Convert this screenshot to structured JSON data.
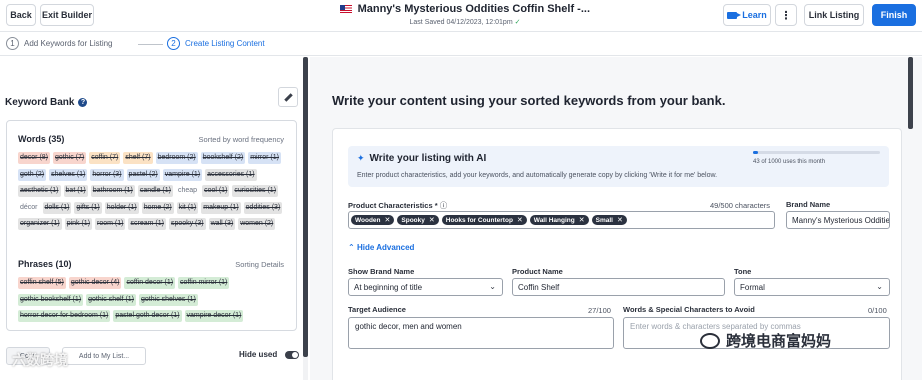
{
  "topbar": {
    "back": "Back",
    "exit": "Exit Builder",
    "title": "Manny's Mysterious Oddities Coffin Shelf -...",
    "saved": "Last Saved 04/12/2023, 12:01pm",
    "learn": "Learn",
    "more": "⋮",
    "link_listing": "Link Listing",
    "finish": "Finish"
  },
  "steps": [
    {
      "num": "1",
      "label": "Add Keywords for Listing"
    },
    {
      "num": "2",
      "label": "Create Listing Content"
    }
  ],
  "keyword_bank": {
    "title": "Keyword Bank",
    "words_title": "Words (35)",
    "words_note": "Sorted by word frequency",
    "words": [
      {
        "text": "decor (8)",
        "c": "p"
      },
      {
        "text": "gothic (7)",
        "c": "p"
      },
      {
        "text": "coffin (7)",
        "c": "o"
      },
      {
        "text": "shelf (7)",
        "c": "o"
      },
      {
        "text": "bedroom (2)",
        "c": "b"
      },
      {
        "text": "bookshelf (2)",
        "c": "b"
      },
      {
        "text": "mirror (1)",
        "c": "b"
      },
      {
        "text": "goth (2)",
        "c": "b"
      },
      {
        "text": "shelves (1)",
        "c": "b"
      },
      {
        "text": "horror (3)",
        "c": "b"
      },
      {
        "text": "pastel (2)",
        "c": "b"
      },
      {
        "text": "vampire (1)",
        "c": "b"
      },
      {
        "text": "accessories (1)",
        "c": "g"
      },
      {
        "text": "aesthetic (1)",
        "c": "g"
      },
      {
        "text": "bat (1)",
        "c": "g"
      },
      {
        "text": "bathroom (1)",
        "c": "g"
      },
      {
        "text": "candle (1)",
        "c": "g"
      },
      {
        "text": "cheap",
        "c": "n"
      },
      {
        "text": "cool (1)",
        "c": "g"
      },
      {
        "text": "curiosities (1)",
        "c": "g"
      },
      {
        "text": "décor",
        "c": "n"
      },
      {
        "text": "dolls (1)",
        "c": "g"
      },
      {
        "text": "gifts (1)",
        "c": "g"
      },
      {
        "text": "holder (1)",
        "c": "g"
      },
      {
        "text": "home (2)",
        "c": "g"
      },
      {
        "text": "kit (1)",
        "c": "g"
      },
      {
        "text": "makeup (1)",
        "c": "g"
      },
      {
        "text": "oddities (3)",
        "c": "g"
      },
      {
        "text": "organizer (1)",
        "c": "g"
      },
      {
        "text": "pink (1)",
        "c": "g"
      },
      {
        "text": "room (1)",
        "c": "g"
      },
      {
        "text": "scream (1)",
        "c": "g"
      },
      {
        "text": "spooky (3)",
        "c": "g"
      },
      {
        "text": "wall (3)",
        "c": "g"
      },
      {
        "text": "women (2)",
        "c": "g"
      }
    ],
    "phrases_title": "Phrases (10)",
    "phrases_note": "Sorting Details",
    "phrases": [
      {
        "text": "coffin shelf (5)",
        "c": "p"
      },
      {
        "text": "gothic decor (4)",
        "c": "p"
      },
      {
        "text": "coffin decor (1)",
        "c": "gr"
      },
      {
        "text": "coffin mirror (1)",
        "c": "gr"
      },
      {
        "text": "gothic bookshelf (1)",
        "c": "gr"
      },
      {
        "text": "gothic shelf (1)",
        "c": "gr"
      },
      {
        "text": "gothic shelves (1)",
        "c": "gr"
      },
      {
        "text": "horror decor for bedroom (1)",
        "c": "gr"
      },
      {
        "text": "pastel goth decor (1)",
        "c": "gr"
      },
      {
        "text": "vampire decor (1)",
        "c": "gr"
      }
    ],
    "copy_btn": "Copy",
    "add_to_list": "Add to My List...",
    "hide_used": "Hide used"
  },
  "main": {
    "headline": "Write your content using your sorted keywords from your bank.",
    "ai": {
      "title": "Write your listing with AI",
      "subtitle": "Enter product characteristics, add your keywords, and automatically generate copy by clicking 'Write it for me' below.",
      "usage_text": "43 of 1000 uses this month",
      "usage_fraction": 0.043
    },
    "product_characteristics": {
      "label": "Product Characteristics *",
      "counter": "49/500 characters",
      "tags": [
        "Wooden",
        "Spooky",
        "Hooks for Countertop",
        "Wall Hanging",
        "Small"
      ]
    },
    "brand_name": {
      "label": "Brand Name",
      "value": "Manny's Mysterious Oddities"
    },
    "hide_advanced": "Hide Advanced",
    "show_brand_name": {
      "label": "Show Brand Name",
      "value": "At beginning of title"
    },
    "product_name": {
      "label": "Product Name",
      "value": "Coffin Shelf"
    },
    "tone": {
      "label": "Tone",
      "value": "Formal"
    },
    "target_audience": {
      "label": "Target Audience",
      "counter": "27/100",
      "value": "gothic decor, men and women"
    },
    "avoid": {
      "label": "Words & Special Characters to Avoid",
      "counter": "0/100",
      "placeholder": "Enter words & characters separated by commas"
    }
  },
  "watermark": {
    "left": "六数跨境",
    "right": "跨境电商富妈妈"
  }
}
